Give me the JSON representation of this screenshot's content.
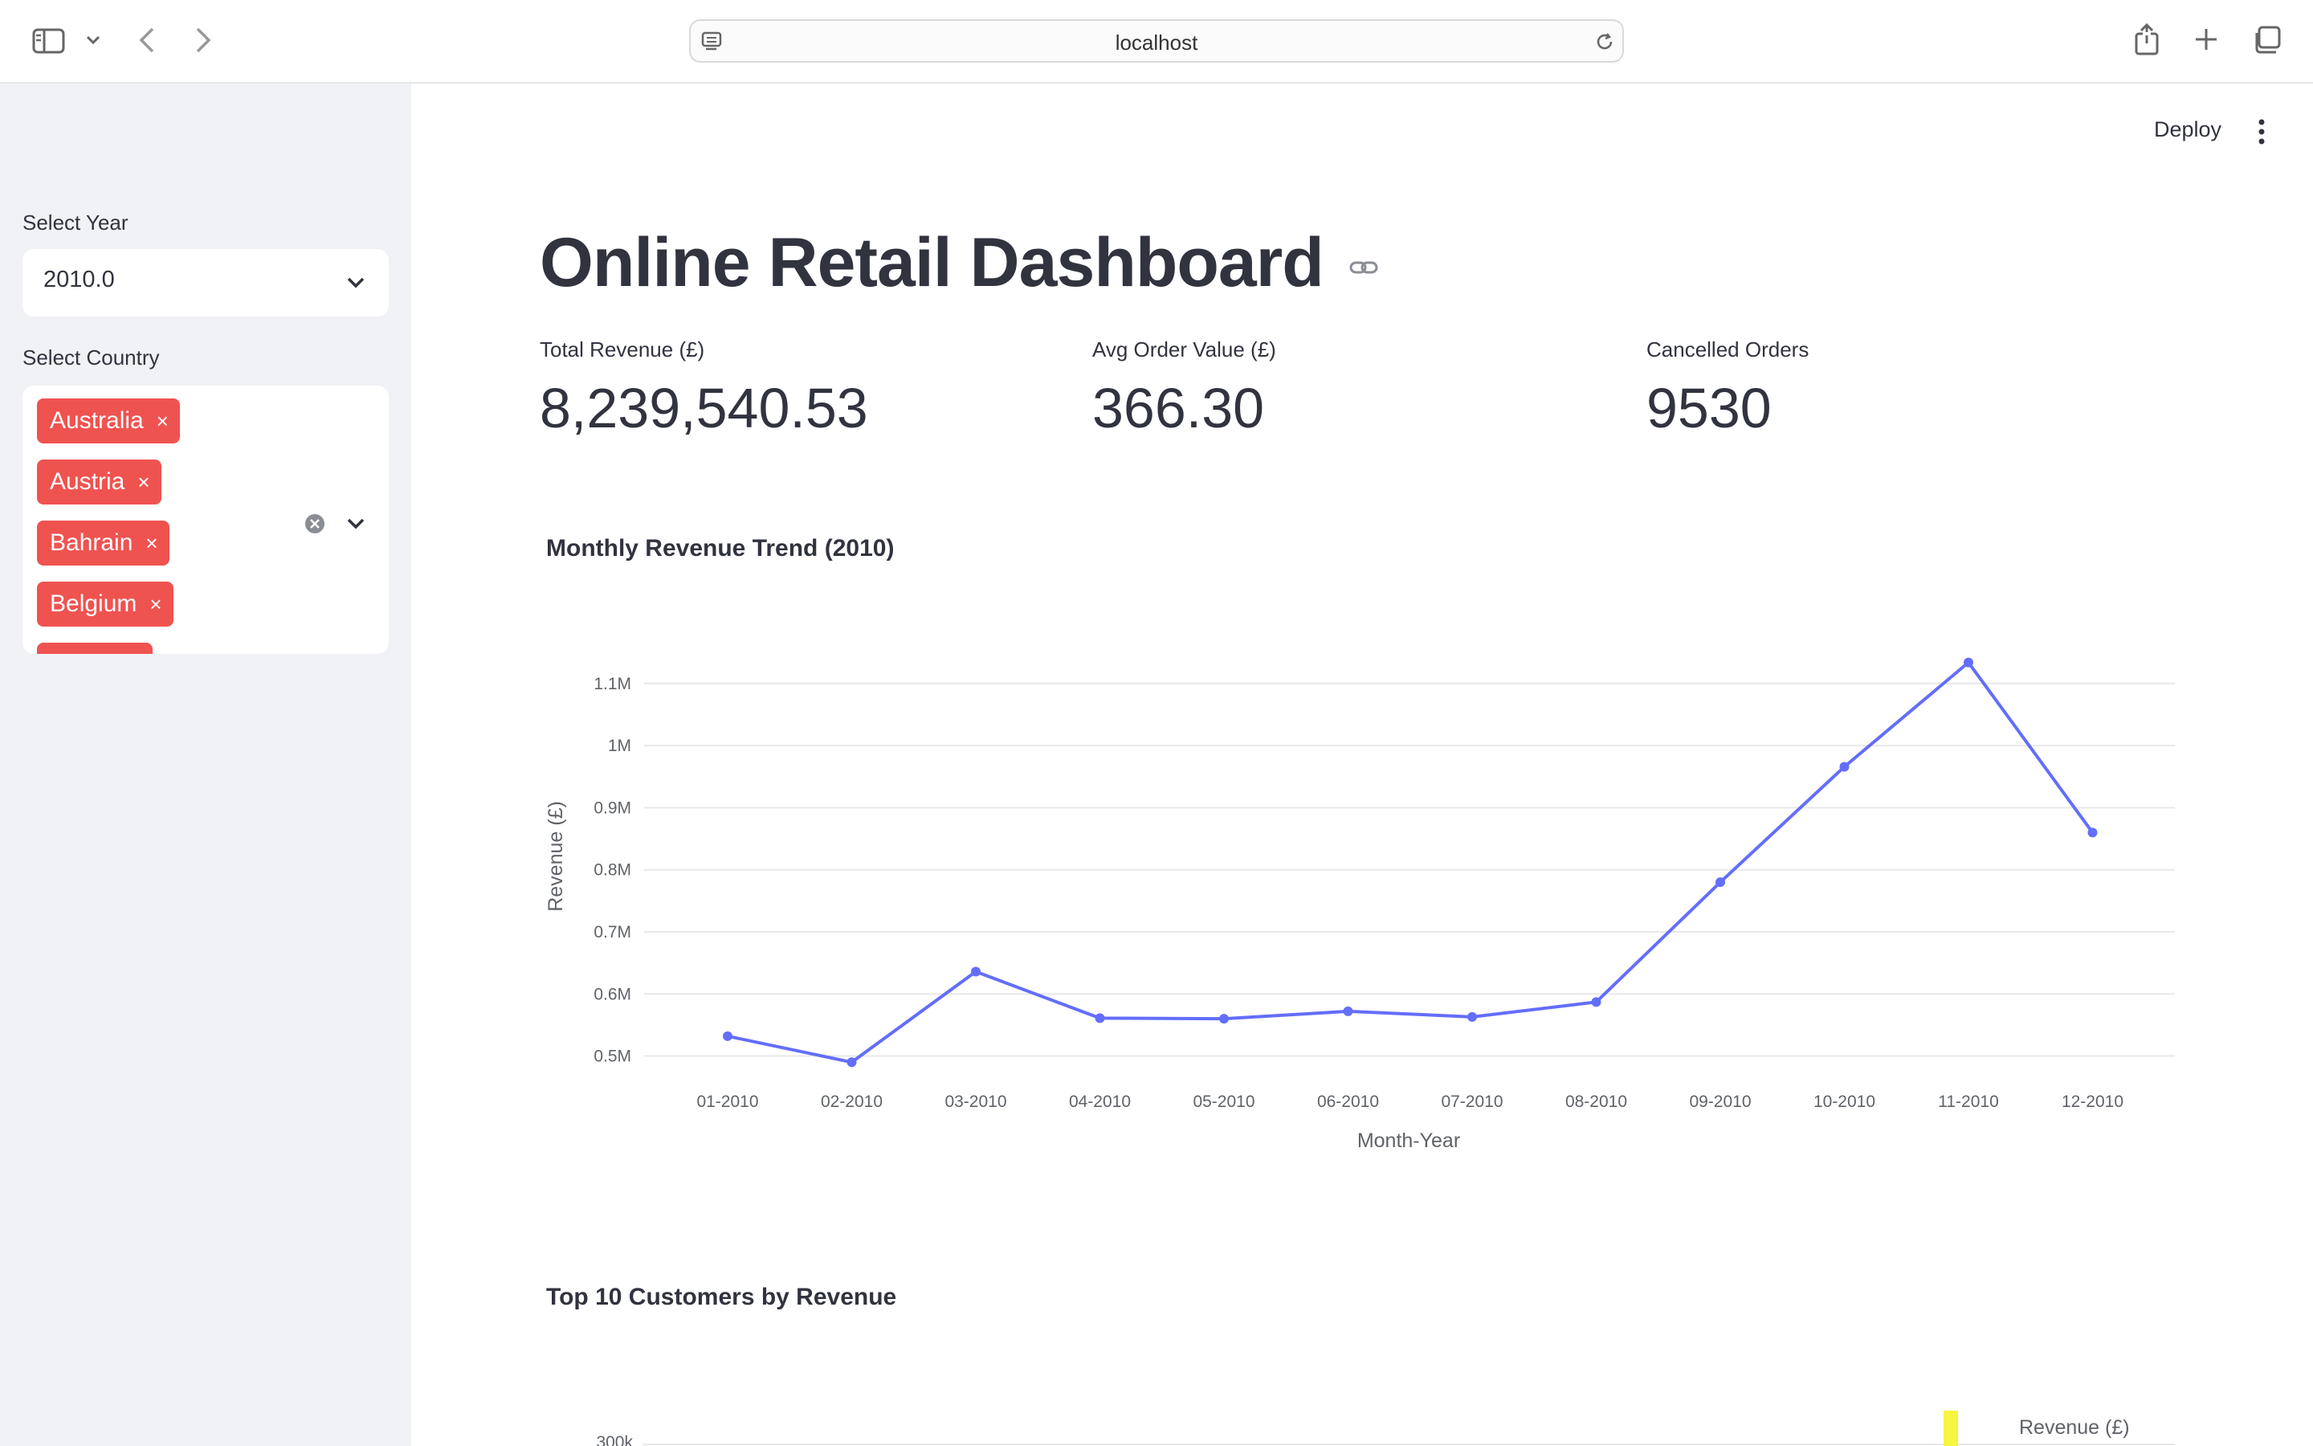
{
  "browser": {
    "url": "localhost"
  },
  "sidebar": {
    "year_label": "Select Year",
    "year_value": "2010.0",
    "country_label": "Select Country",
    "countries": [
      "Australia",
      "Austria",
      "Bahrain",
      "Belgium"
    ],
    "chip_remove_glyph": "×"
  },
  "header": {
    "deploy_label": "Deploy"
  },
  "main": {
    "title": "Online Retail Dashboard",
    "metrics": [
      {
        "label": "Total Revenue (£)",
        "value": "8,239,540.53"
      },
      {
        "label": "Avg Order Value (£)",
        "value": "366.30"
      },
      {
        "label": "Cancelled Orders",
        "value": "9530"
      }
    ],
    "chart1_title": "Monthly Revenue Trend (2010)",
    "chart2_title": "Top 10 Customers by Revenue",
    "chart2_partial_tick": "300k",
    "chart2_legend": "Revenue (£)"
  },
  "colors": {
    "accent": "#ef5350",
    "line": "#636efa",
    "sidebar_bg": "#f0f2f6",
    "legend_bar": "#f5f542"
  },
  "chart_data": {
    "type": "line",
    "x": [
      "01-2010",
      "02-2010",
      "03-2010",
      "04-2010",
      "05-2010",
      "06-2010",
      "07-2010",
      "08-2010",
      "09-2010",
      "10-2010",
      "11-2010",
      "12-2010"
    ],
    "y": [
      532000,
      490000,
      636000,
      561000,
      560000,
      572000,
      563000,
      587000,
      780000,
      966000,
      1134000,
      860000
    ],
    "yticks": [
      "0.5M",
      "0.6M",
      "0.7M",
      "0.8M",
      "0.9M",
      "1M",
      "1.1M"
    ],
    "ytick_values": [
      500000,
      600000,
      700000,
      800000,
      900000,
      1000000,
      1100000
    ],
    "xlabel": "Month-Year",
    "ylabel": "Revenue (£)",
    "ylim": [
      480000,
      1140000
    ],
    "grid": true,
    "markers": true
  }
}
